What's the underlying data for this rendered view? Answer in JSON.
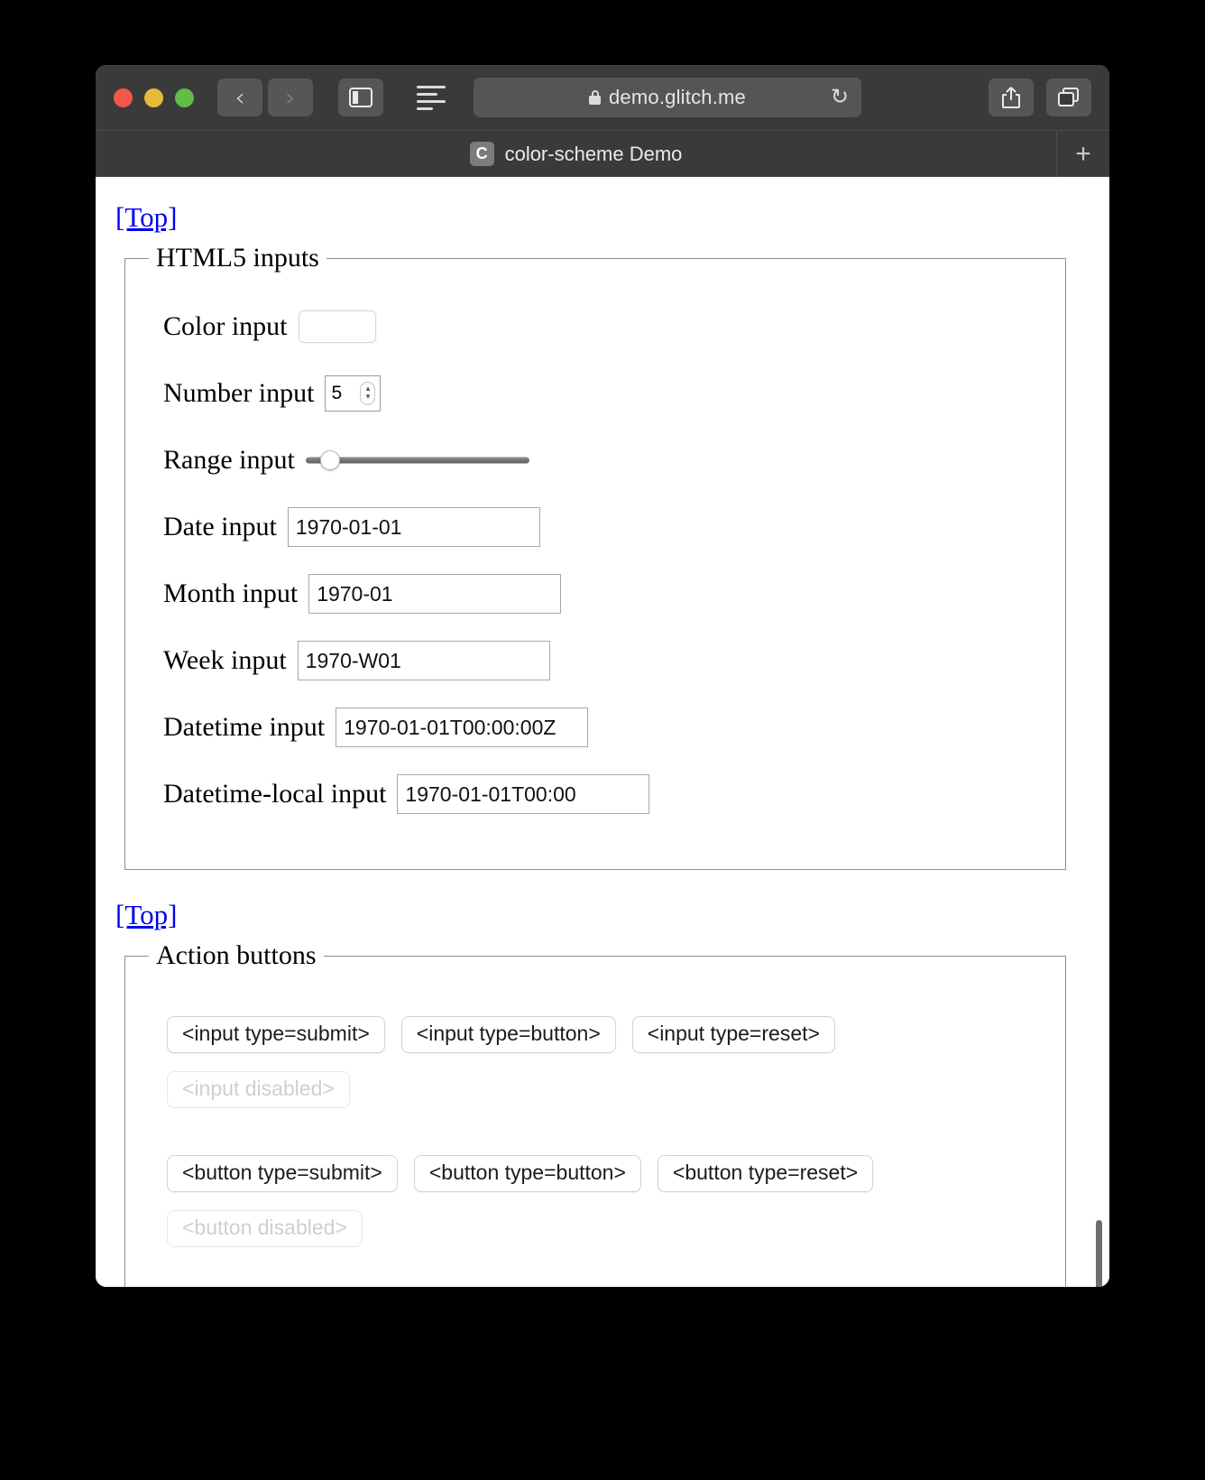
{
  "browser": {
    "traffic_lights": [
      "close",
      "minimize",
      "zoom"
    ],
    "back_label": "‹",
    "forward_label": "›",
    "sidebar_icon": "sidebar-icon",
    "reader_icon": "reader-view-icon",
    "lock_icon": "lock-icon",
    "url": "demo.glitch.me",
    "reload_label": "↻",
    "share_icon": "share-icon",
    "tabs_icon": "show-tabs-icon",
    "new_tab_label": "+",
    "tab": {
      "favicon_letter": "C",
      "title": "color-scheme Demo"
    }
  },
  "page": {
    "top_link_1": "[Top]",
    "top_link_2": "[Top]",
    "html5_inputs": {
      "legend": "HTML5 inputs",
      "fields": [
        {
          "label": "Color input",
          "type": "color",
          "value": "#000000"
        },
        {
          "label": "Number input",
          "type": "number",
          "value": "5"
        },
        {
          "label": "Range input",
          "type": "range",
          "value": "11"
        },
        {
          "label": "Date input",
          "type": "date",
          "value": "1970-01-01"
        },
        {
          "label": "Month input",
          "type": "month",
          "value": "1970-01"
        },
        {
          "label": "Week input",
          "type": "week",
          "value": "1970-W01"
        },
        {
          "label": "Datetime input",
          "type": "text",
          "value": "1970-01-01T00:00:00Z"
        },
        {
          "label": "Datetime-local input",
          "type": "text",
          "value": "1970-01-01T00:00"
        }
      ]
    },
    "action_buttons": {
      "legend": "Action buttons",
      "input_row": [
        "<input type=submit>",
        "<input type=button>",
        "<input type=reset>"
      ],
      "input_disabled": "<input disabled>",
      "button_row": [
        "<button type=submit>",
        "<button type=button>",
        "<button type=reset>"
      ],
      "button_disabled": "<button disabled>"
    }
  },
  "colors": {
    "link": "#0000ee",
    "chrome": "#3a3a3a",
    "color_swatch": "#000000"
  }
}
